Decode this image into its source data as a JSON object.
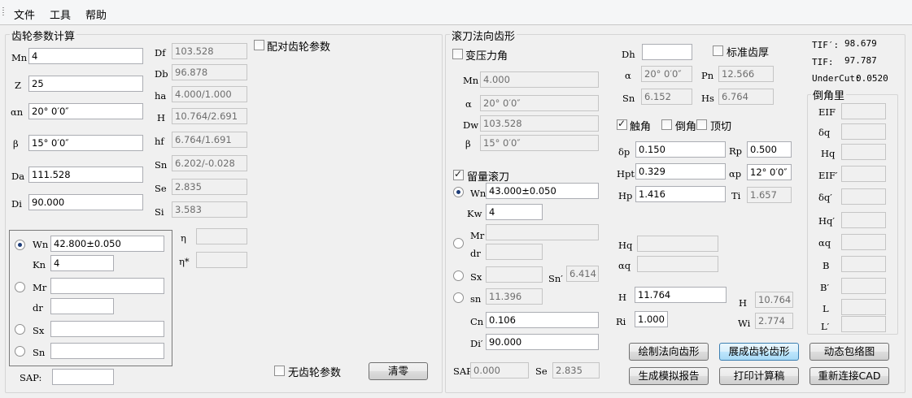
{
  "menu": {
    "file": "文件",
    "tools": "工具",
    "help": "帮助"
  },
  "left_group": {
    "title": "齿轮参数计算",
    "mn_label": "Mn",
    "mn_value": "4",
    "z_label": "Z",
    "z_value": "25",
    "alpha_n_label": "αn",
    "alpha_n_value": "20° 0′0″",
    "beta_label": "β",
    "beta_value": "15° 0′0″",
    "da_label": "Da",
    "da_value": "111.528",
    "di_label": "Di",
    "di_value": "90.000",
    "df_label": "Df",
    "df_value": "103.528",
    "db_label": "Db",
    "db_value": "96.878",
    "ha_label": "ha",
    "ha_value": "4.000/1.000",
    "h_label": "H",
    "h_value": "10.764/2.691",
    "hf_label": "hf",
    "hf_value": "6.764/1.691",
    "sn_label": "Sn",
    "sn_value": "6.202/-0.028",
    "se_label": "Se",
    "se_value": "2.835",
    "si_label": "Si",
    "si_value": "3.583",
    "pair_gear_label": "配对齿轮参数",
    "wn_label": "Wn",
    "wn_value": "42.800±0.050",
    "kn_label": "Kn",
    "kn_value": "4",
    "mr_label": "Mr",
    "mr_value": "",
    "dr_label": "dr",
    "dr_value": "",
    "sx_label": "Sx",
    "sx_value": "",
    "sn2_label": "Sn",
    "sn2_value": "",
    "eta_label": "η",
    "eta_value": "",
    "eta_star_label": "η*",
    "eta_star_value": "",
    "sap_label": "SAP:",
    "sap_value": "",
    "no_gear_label": "无齿轮参数",
    "clear_button": "清零"
  },
  "right_group": {
    "title": "滚刀法向齿形",
    "variable_pressure_label": "变压力角",
    "mn_label": "Mn",
    "mn_value": "4.000",
    "alpha_label": "α",
    "alpha_value": "20° 0′0″",
    "dw_label": "Dw",
    "dw_value": "103.528",
    "beta_label": "β",
    "beta_value": "15° 0′0″",
    "dh_label": "Dh",
    "dh_value": "",
    "standard_thickness_label": "标准齿厚",
    "alpha2_label": "α",
    "alpha2_value": "20° 0′0″",
    "pn_label": "Pn",
    "pn_value": "12.566",
    "sn_label": "Sn",
    "sn_value": "6.152",
    "hs_label": "Hs",
    "hs_value": "6.764",
    "protuberance_label": "触角",
    "chamfer_label": "倒角",
    "tip_relief_label": "顶切",
    "delta_p_label": "δp",
    "delta_p_value": "0.150",
    "rp_label": "Rp",
    "rp_value": "0.500",
    "hpt_label": "Hpt",
    "hpt_value": "0.329",
    "alpha_p_label": "αp",
    "alpha_p_value": "12° 0′0″",
    "hp_label": "Hp",
    "hp_value": "1.416",
    "ti_label": "Ti",
    "ti_value": "1.657",
    "reserve_label": "留量滚刀",
    "wn_label": "Wn",
    "wn_value": "43.000±0.050",
    "kw_label": "Kw",
    "kw_value": "4",
    "mr_label": "Mr",
    "mr_value": "",
    "dr_label": "dr",
    "dr_value": "",
    "sx_label": "Sx",
    "sx_value": "",
    "sn_prime_label": "Sn′",
    "sn_prime_value": "6.414",
    "sn_small_label": "sn",
    "sn_small_value": "11.396",
    "cn_label": "Cn",
    "cn_value": "0.106",
    "di_prime_label": "Di′",
    "di_prime_value": "90.000",
    "sap_label": "SAP",
    "sap_value": "0.000",
    "se_label": "Se",
    "se_value": "2.835",
    "hq_label": "Hq",
    "hq_value": "",
    "alpha_q_label": "αq",
    "alpha_q_value": "",
    "h_label": "H",
    "h_value": "11.764",
    "h2_label": "H",
    "h2_value": "10.764",
    "ri_label": "Ri",
    "ri_value": "1.000",
    "wi_label": "Wi",
    "wi_value": "2.774",
    "tif_prime_label": "TIF′:",
    "tif_prime_value": "98.679",
    "tif_label": "TIF:",
    "tif_value": "97.787",
    "undercut_label": "UnderCut:",
    "undercut_value": "0.0520",
    "chamfer_group_title": "倒角里",
    "chamfer_fields": [
      {
        "label": "EIF",
        "value": ""
      },
      {
        "label": "δq",
        "value": ""
      },
      {
        "label": "Hq",
        "value": ""
      },
      {
        "label": "EIF′",
        "value": ""
      },
      {
        "label": "δq′",
        "value": ""
      },
      {
        "label": "Hq′",
        "value": ""
      },
      {
        "label": "αq",
        "value": ""
      },
      {
        "label": "B",
        "value": ""
      },
      {
        "label": "B′",
        "value": ""
      },
      {
        "label": "L",
        "value": ""
      },
      {
        "label": "L′",
        "value": ""
      }
    ],
    "buttons": {
      "draw_normal": "绘制法向齿形",
      "unfold_gear": "展成齿轮齿形",
      "dynamic_envelope": "动态包络图",
      "simulate_report": "生成模拟报告",
      "print_sheet": "打印计算稿",
      "reconnect_cad": "重新连接CAD"
    }
  }
}
